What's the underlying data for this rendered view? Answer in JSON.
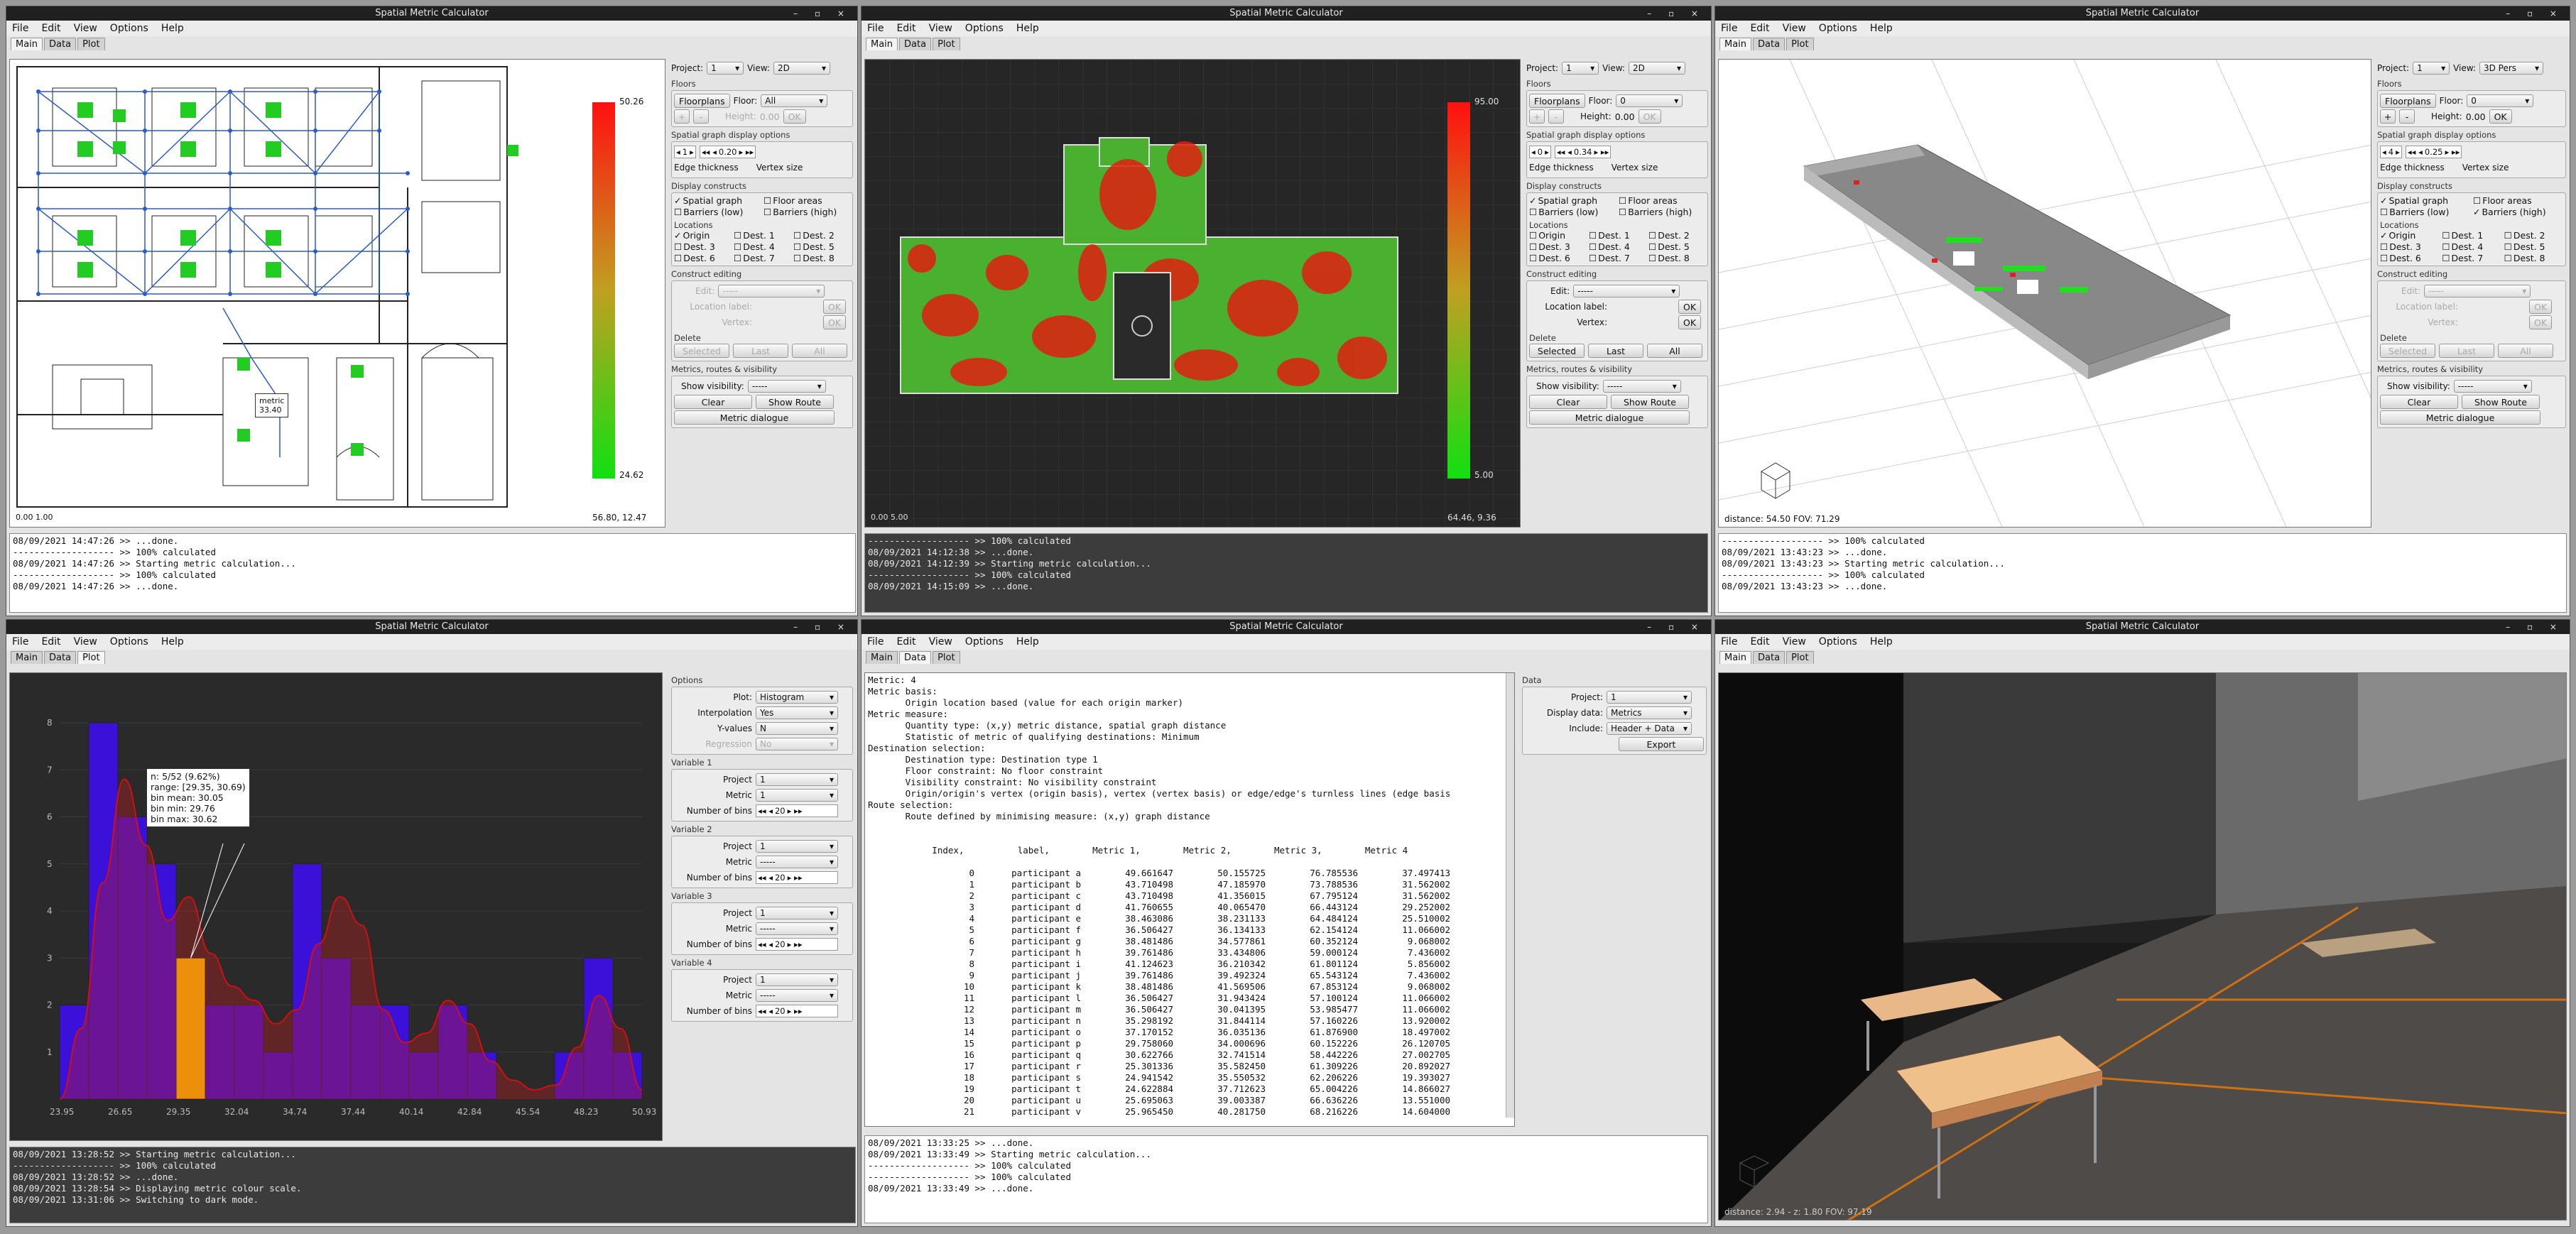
{
  "app_title": "Spatial Metric Calculator",
  "menu": [
    "File",
    "Edit",
    "View",
    "Options",
    "Help"
  ],
  "tabs": [
    "Main",
    "Data",
    "Plot"
  ],
  "win_controls": "– ▫ ×",
  "panel": {
    "project_label": "Project:",
    "view_label": "View:",
    "floors": "Floors",
    "floorplans": "Floorplans",
    "floor_label": "Floor:",
    "height_label": "Height:",
    "sgdo": "Spatial graph display options",
    "edge_thickness": "Edge thickness",
    "vertex_size": "Vertex size",
    "display_constructs": "Display constructs",
    "spatial_graph": "Spatial graph",
    "floor_areas": "Floor areas",
    "barriers_low": "Barriers (low)",
    "barriers_high": "Barriers (high)",
    "locations": "Locations",
    "origin": "Origin",
    "dests": [
      "Dest. 1",
      "Dest. 2",
      "Dest. 3",
      "Dest. 4",
      "Dest. 5",
      "Dest. 6",
      "Dest. 7",
      "Dest. 8"
    ],
    "construct_editing": "Construct editing",
    "edit_label": "Edit:",
    "edit_val": "-----",
    "location_label": "Location label:",
    "vertex_label": "Vertex:",
    "ok": "OK",
    "delete": "Delete",
    "selected": "Selected",
    "last": "Last",
    "all": "All",
    "mrv": "Metrics, routes & visibility",
    "show_visibility": "Show visibility:",
    "vis_val": "-----",
    "clear": "Clear",
    "show_route": "Show Route",
    "metric_dialogue": "Metric dialogue",
    "plus": "+",
    "minus": "-"
  },
  "w1": {
    "project": "1",
    "view": "2D",
    "floor": "All",
    "height": "0.00",
    "edge": "1",
    "vsize": "0.20",
    "scale_top": "50.26",
    "scale_bot": "24.62",
    "coords": "56.80,  12.47",
    "axis_label": "0.00   1.00",
    "metric_tip": [
      "metric",
      "33.40"
    ],
    "log": [
      "08/09/2021 14:47:26 >> ...done.",
      "------------------- >> 100% calculated",
      "08/09/2021 14:47:26 >> Starting metric calculation...",
      "------------------- >> 100% calculated",
      "08/09/2021 14:47:26 >> ...done."
    ]
  },
  "w2": {
    "project": "1",
    "view": "2D",
    "floor": "0",
    "height": "0.00",
    "edge": "0",
    "vsize": "0.34",
    "scale_top": "95.00",
    "scale_bot": "5.00",
    "coords": "64.46,  9.36",
    "axis_label": "0.00   5.00",
    "log": [
      "------------------- >> 100% calculated",
      "08/09/2021 14:12:38 >> ...done.",
      "08/09/2021 14:12:39 >> Starting metric calculation...",
      "------------------- >> 100% calculated",
      "08/09/2021 14:15:09 >> ...done."
    ]
  },
  "w3": {
    "project": "1",
    "view": "3D Pers",
    "floor": "0",
    "height": "0.00",
    "edge": "4",
    "vsize": "0.25",
    "status": "distance: 54.50   FOV: 71.29",
    "log": [
      "------------------- >> 100% calculated",
      "08/09/2021 13:43:23 >> ...done.",
      "08/09/2021 13:43:23 >> Starting metric calculation...",
      "------------------- >> 100% calculated",
      "08/09/2021 13:43:23 >> ...done."
    ]
  },
  "w4": {
    "options": "Options",
    "plot_label": "Plot:",
    "plot_val": "Histogram",
    "interp_label": "Interpolation",
    "interp_val": "Yes",
    "yvals_label": "Y-values",
    "yvals_val": "N",
    "reg_label": "Regression",
    "reg_val": "No",
    "vars": [
      {
        "title": "Variable 1",
        "project": "1",
        "metric": "1",
        "bins": "20"
      },
      {
        "title": "Variable 2",
        "project": "1",
        "metric": "-----",
        "bins": "20"
      },
      {
        "title": "Variable 3",
        "project": "1",
        "metric": "-----",
        "bins": "20"
      },
      {
        "title": "Variable 4",
        "project": "1",
        "metric": "-----",
        "bins": "20"
      }
    ],
    "project_label": "Project",
    "metric_label": "Metric",
    "bins_label": "Number of bins",
    "tooltip": [
      "n:  5/52  (9.62%)",
      "range:  [29.35,  30.69)",
      "bin  mean:  30.05",
      "bin  min:  29.76",
      "bin  max:  30.62"
    ],
    "log": [
      "08/09/2021 13:28:52 >> Starting metric calculation...",
      "------------------- >> 100% calculated",
      "08/09/2021 13:28:52 >> ...done.",
      "08/09/2021 13:28:54 >> Displaying metric colour scale.",
      "08/09/2021 13:31:06 >> Switching to dark mode."
    ]
  },
  "chart_data": {
    "type": "bar",
    "xlim": [
      23.95,
      50.93
    ],
    "ylim": [
      0,
      8
    ],
    "tick_labels": [
      "23.95",
      "26.65",
      "29.35",
      "32.04",
      "34.74",
      "37.44",
      "40.14",
      "42.84",
      "45.54",
      "48.23",
      "50.93"
    ],
    "yticks": [
      "1",
      "2",
      "3",
      "4",
      "5",
      "6",
      "7",
      "8"
    ],
    "values": [
      2,
      8,
      6,
      5,
      3,
      2,
      2,
      1,
      5,
      3,
      2,
      2,
      1,
      2,
      1,
      0,
      0,
      1,
      3,
      1
    ],
    "highlight_bin": 4,
    "curve": [
      0,
      1.5,
      4.6,
      6.8,
      5.4,
      3.8,
      4.3,
      3.1,
      2.4,
      2.1,
      1.6,
      1.9,
      3.3,
      4.3,
      3.7,
      1.9,
      1.2,
      1.4,
      2.1,
      1.6,
      0.8,
      0.4,
      0.2,
      0.3,
      1.1,
      2.2,
      1.5,
      0.2
    ]
  },
  "w5": {
    "data_label": "Data",
    "project_label": "Project:",
    "project": "1",
    "display_label": "Display data:",
    "display": "Metrics",
    "include_label": "Include:",
    "include": "Header + Data",
    "export": "Export",
    "header": [
      "Metric: 4",
      "Metric basis:",
      "       Origin location based (value for each origin marker)",
      "Metric measure:",
      "       Quantity type: (x,y) metric distance, spatial graph distance",
      "       Statistic of metric of qualifying destinations: Minimum",
      "Destination selection:",
      "       Destination type: Destination type 1",
      "       Floor constraint: No floor constraint",
      "       Visibility constraint: No visibility constraint",
      "       Origin/origin's vertex (origin basis), vertex (vertex basis) or edge/edge's turnless lines (edge basis",
      "Route selection:",
      "       Route defined by minimising measure: (x,y) graph distance",
      "",
      "",
      "            Index,          label,        Metric 1,        Metric 2,        Metric 3,        Metric 4",
      ""
    ],
    "rows": [
      [
        "0",
        "participant a",
        "49.661647",
        "50.155725",
        "76.785536",
        "37.497413"
      ],
      [
        "1",
        "participant b",
        "43.710498",
        "47.185970",
        "73.788536",
        "31.562002"
      ],
      [
        "2",
        "participant c",
        "43.710498",
        "41.356015",
        "67.795124",
        "31.562002"
      ],
      [
        "3",
        "participant d",
        "41.760655",
        "40.065470",
        "66.443124",
        "29.252002"
      ],
      [
        "4",
        "participant e",
        "38.463086",
        "38.231133",
        "64.484124",
        "25.510002"
      ],
      [
        "5",
        "participant f",
        "36.506427",
        "36.134133",
        "62.154124",
        "11.066002"
      ],
      [
        "6",
        "participant g",
        "38.481486",
        "34.577861",
        "60.352124",
        "9.068002"
      ],
      [
        "7",
        "participant h",
        "39.761486",
        "33.434806",
        "59.000124",
        "7.436002"
      ],
      [
        "8",
        "participant i",
        "41.124623",
        "36.210342",
        "61.801124",
        "5.856002"
      ],
      [
        "9",
        "participant j",
        "39.761486",
        "39.492324",
        "65.543124",
        "7.436002"
      ],
      [
        "10",
        "participant k",
        "38.481486",
        "41.569506",
        "67.853124",
        "9.068002"
      ],
      [
        "11",
        "participant l",
        "36.506427",
        "31.943424",
        "57.100124",
        "11.066002"
      ],
      [
        "12",
        "participant m",
        "36.506427",
        "30.041395",
        "53.985477",
        "11.066002"
      ],
      [
        "13",
        "participant n",
        "35.298192",
        "31.844114",
        "57.160226",
        "13.920002"
      ],
      [
        "14",
        "participant o",
        "37.170152",
        "36.035136",
        "61.876900",
        "18.497002"
      ],
      [
        "15",
        "participant p",
        "29.758060",
        "34.000696",
        "60.152226",
        "26.120705"
      ],
      [
        "16",
        "participant q",
        "30.622766",
        "32.741514",
        "58.442226",
        "27.002705"
      ],
      [
        "17",
        "participant r",
        "25.301336",
        "35.582450",
        "61.309226",
        "20.892027"
      ],
      [
        "18",
        "participant s",
        "24.941542",
        "35.550532",
        "62.206226",
        "19.393027"
      ],
      [
        "19",
        "participant t",
        "24.622884",
        "37.712623",
        "65.004226",
        "14.866027"
      ],
      [
        "20",
        "participant u",
        "25.695063",
        "39.003387",
        "66.636226",
        "13.551000"
      ],
      [
        "21",
        "participant v",
        "25.965450",
        "40.281750",
        "68.216226",
        "14.604000"
      ]
    ],
    "log": [
      "08/09/2021 13:33:25 >> ...done.",
      "08/09/2021 13:33:49 >> Starting metric calculation...",
      "------------------- >> 100% calculated",
      "------------------- >> 100% calculated",
      "08/09/2021 13:33:49 >> ...done."
    ]
  },
  "w6": {
    "status": "distance: 2.94   -  z: 1.80   FOV: 97.19"
  },
  "colors": {
    "accent": "#2f5fd0",
    "hist_bar": "#3b10d8",
    "highlight": "#ffcc00",
    "curve": "#d01010"
  }
}
